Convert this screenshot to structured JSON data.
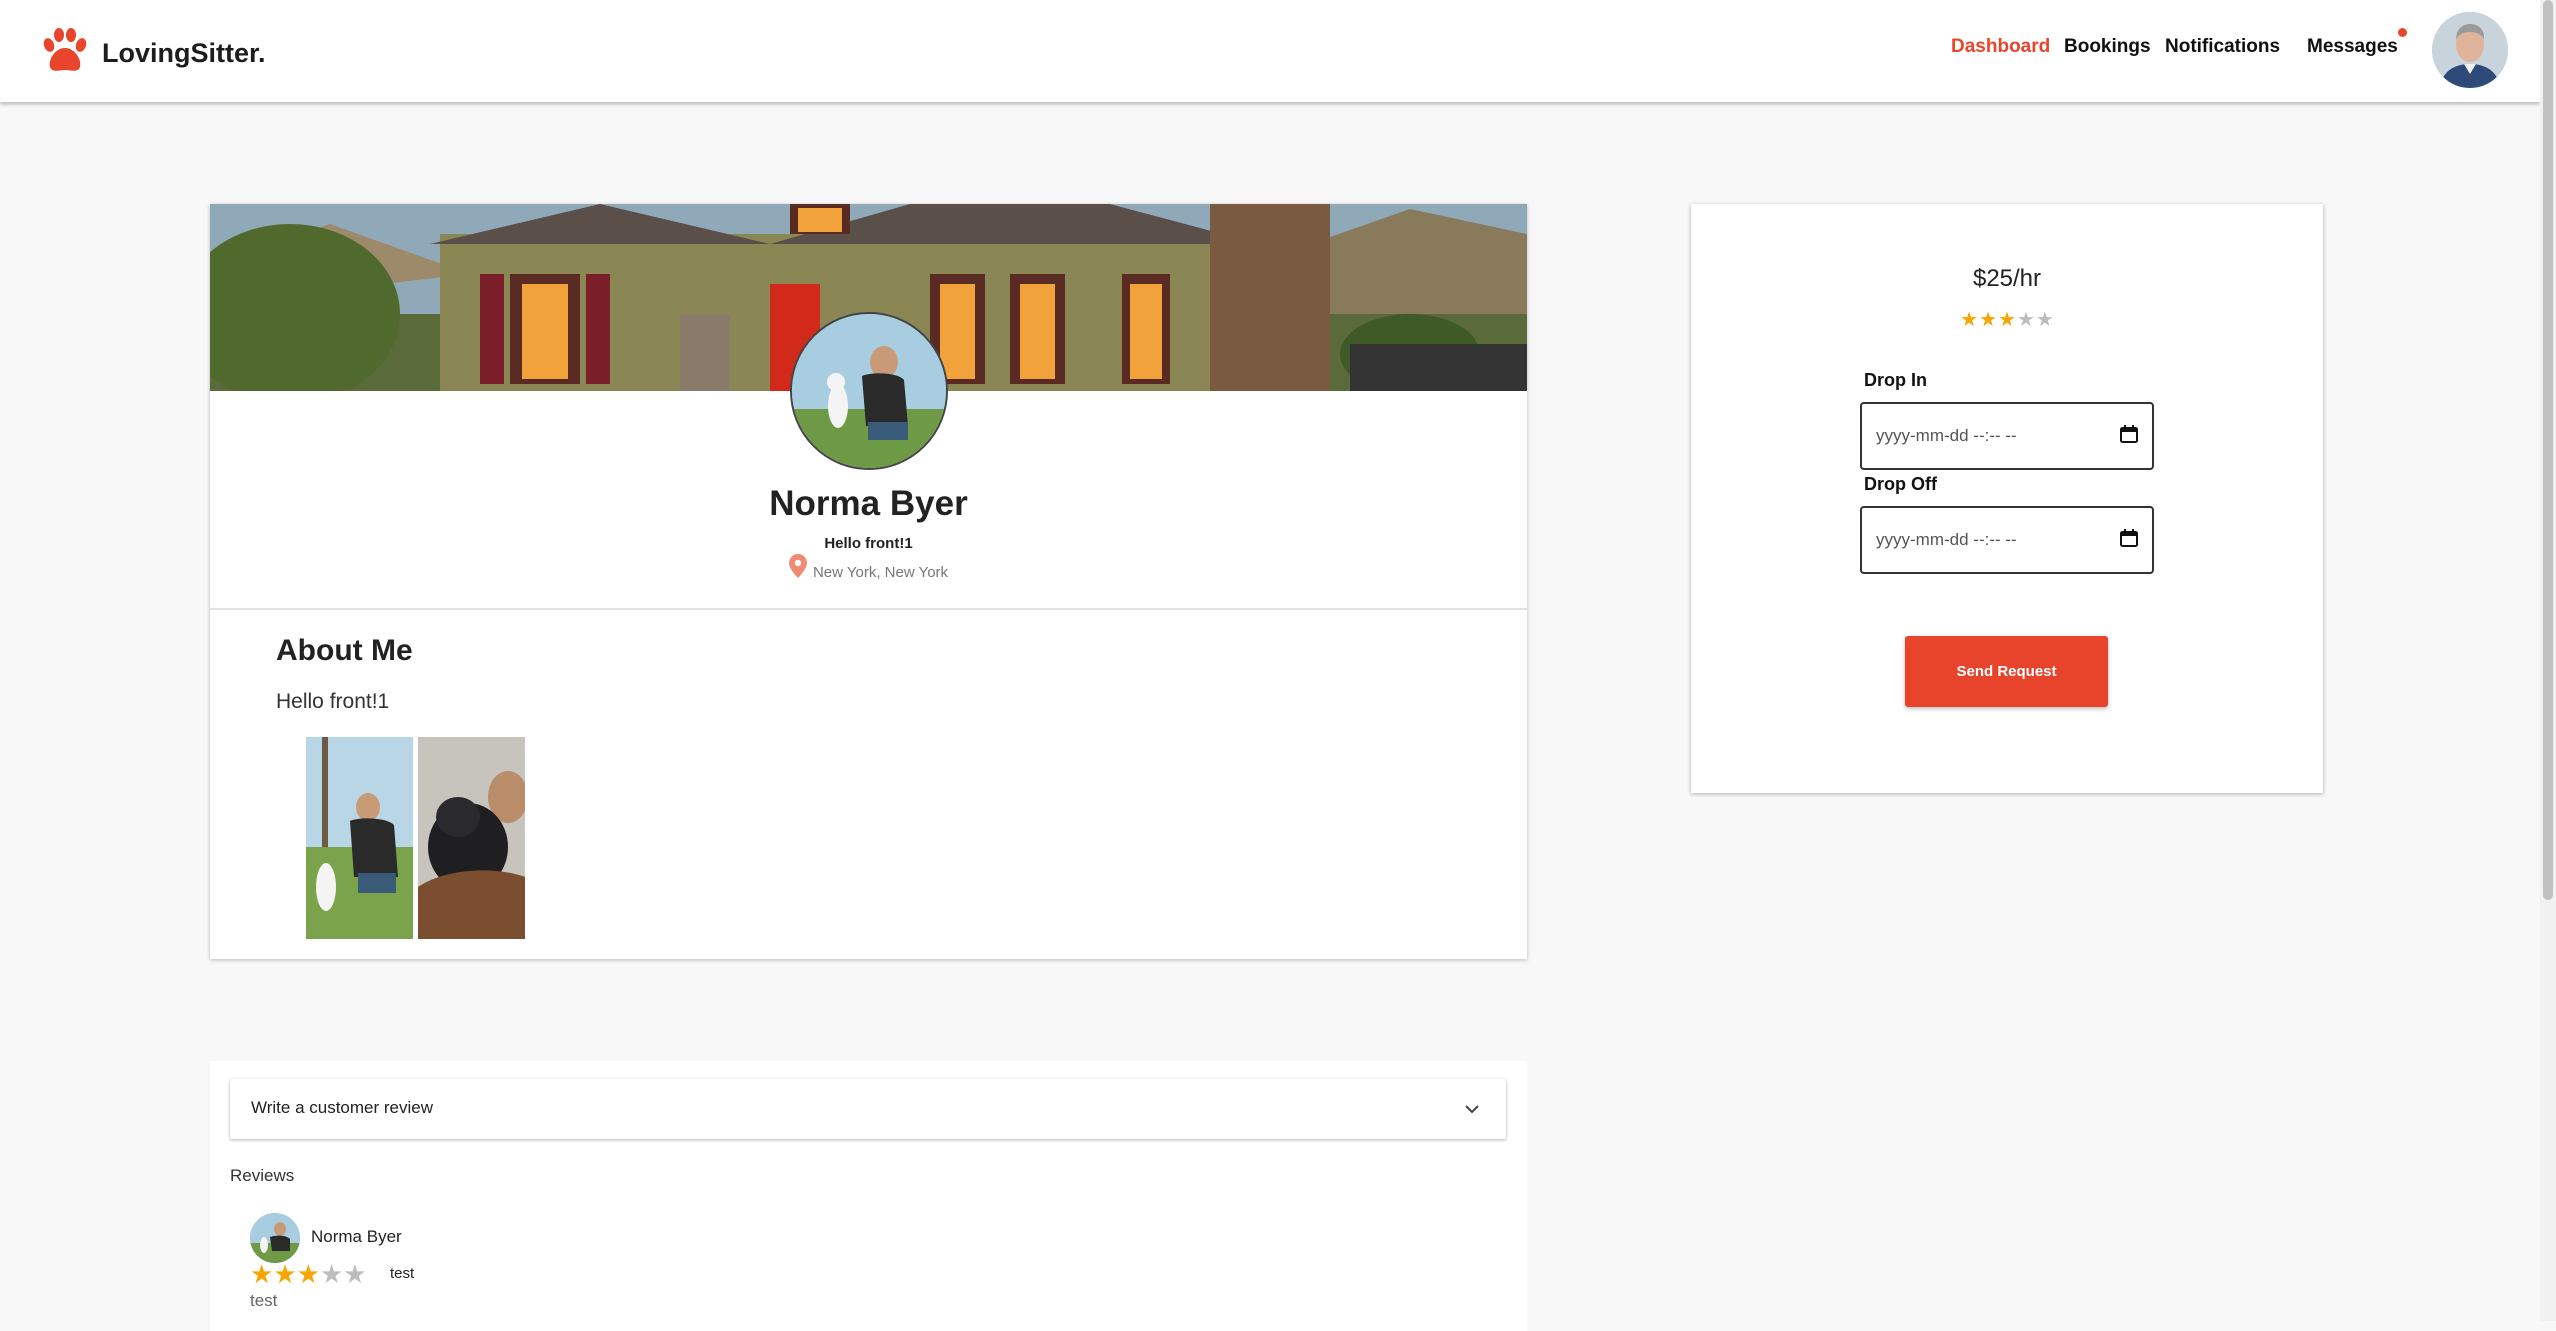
{
  "brand": {
    "name": "LovingSitter.",
    "accent": "#e8452c"
  },
  "nav": {
    "items": [
      {
        "label": "Dashboard",
        "active": true
      },
      {
        "label": "Bookings",
        "active": false
      },
      {
        "label": "Notifications",
        "active": false
      },
      {
        "label": "Messages",
        "active": false
      }
    ],
    "messages_has_unread": true
  },
  "profile": {
    "name": "Norma Byer",
    "tagline": "Hello front!1",
    "location": "New York, New York",
    "about_title": "About Me",
    "about_text": "Hello front!1"
  },
  "booking": {
    "price": "$25/hr",
    "rating": 3,
    "rating_max": 5,
    "drop_in_label": "Drop In",
    "drop_in_placeholder": "yyyy-mm-dd --:-- --",
    "drop_off_label": "Drop Off",
    "drop_off_placeholder": "yyyy-mm-dd --:-- --",
    "send_label": "Send Request"
  },
  "reviews": {
    "write_label": "Write a customer review",
    "heading": "Reviews",
    "items": [
      {
        "reviewer": "Norma Byer",
        "rating": 3,
        "rating_max": 5,
        "title": "test",
        "body": "test"
      }
    ]
  }
}
